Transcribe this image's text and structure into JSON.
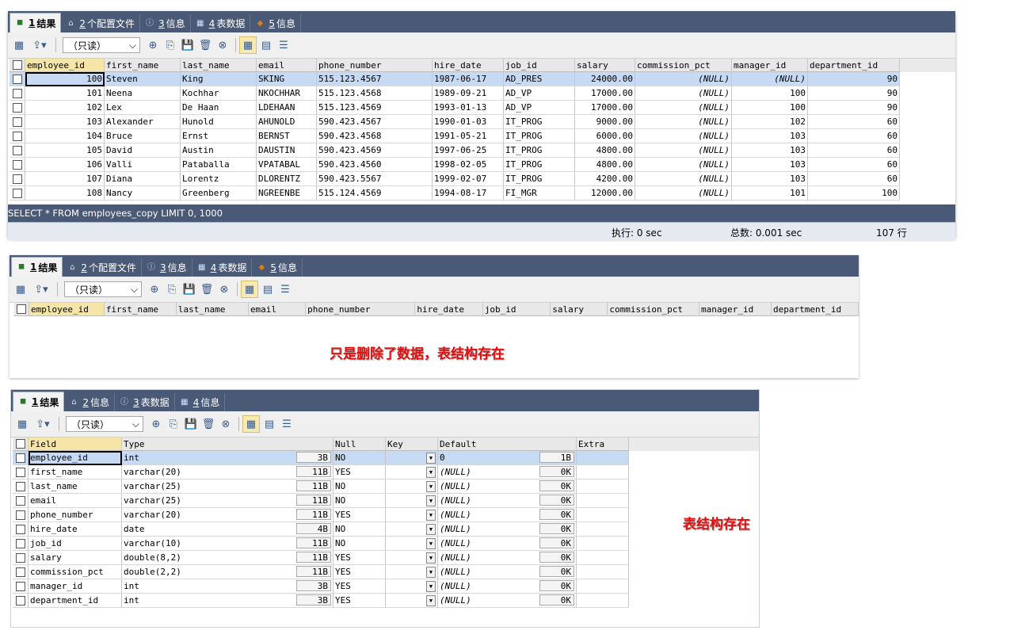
{
  "panel1": {
    "tabs": [
      {
        "num": "1",
        "label": "结果"
      },
      {
        "num": "2",
        "label": "个配置文件"
      },
      {
        "num": "3",
        "label": "信息"
      },
      {
        "num": "4",
        "label": "表数据"
      },
      {
        "num": "5",
        "label": "信息"
      }
    ],
    "readonly": "（只读）",
    "columns": [
      "employee_id",
      "first_name",
      "last_name",
      "email",
      "phone_number",
      "hire_date",
      "job_id",
      "salary",
      "commission_pct",
      "manager_id",
      "department_id"
    ],
    "rows": [
      [
        "100",
        "Steven",
        "King",
        "SKING",
        "515.123.4567",
        "1987-06-17",
        "AD_PRES",
        "24000.00",
        "(NULL)",
        "(NULL)",
        "90"
      ],
      [
        "101",
        "Neena",
        "Kochhar",
        "NKOCHHAR",
        "515.123.4568",
        "1989-09-21",
        "AD_VP",
        "17000.00",
        "(NULL)",
        "100",
        "90"
      ],
      [
        "102",
        "Lex",
        "De Haan",
        "LDEHAAN",
        "515.123.4569",
        "1993-01-13",
        "AD_VP",
        "17000.00",
        "(NULL)",
        "100",
        "90"
      ],
      [
        "103",
        "Alexander",
        "Hunold",
        "AHUNOLD",
        "590.423.4567",
        "1990-01-03",
        "IT_PROG",
        "9000.00",
        "(NULL)",
        "102",
        "60"
      ],
      [
        "104",
        "Bruce",
        "Ernst",
        "BERNST",
        "590.423.4568",
        "1991-05-21",
        "IT_PROG",
        "6000.00",
        "(NULL)",
        "103",
        "60"
      ],
      [
        "105",
        "David",
        "Austin",
        "DAUSTIN",
        "590.423.4569",
        "1997-06-25",
        "IT_PROG",
        "4800.00",
        "(NULL)",
        "103",
        "60"
      ],
      [
        "106",
        "Valli",
        "Pataballa",
        "VPATABAL",
        "590.423.4560",
        "1998-02-05",
        "IT_PROG",
        "4800.00",
        "(NULL)",
        "103",
        "60"
      ],
      [
        "107",
        "Diana",
        "Lorentz",
        "DLORENTZ",
        "590.423.5567",
        "1999-02-07",
        "IT_PROG",
        "4200.00",
        "(NULL)",
        "103",
        "60"
      ],
      [
        "108",
        "Nancy",
        "Greenberg",
        "NGREENBE",
        "515.124.4569",
        "1994-08-17",
        "FI_MGR",
        "12000.00",
        "(NULL)",
        "101",
        "100"
      ]
    ],
    "query": "SELECT * FROM employees_copy LIMIT 0, 1000",
    "exec_time": "执行: 0 sec",
    "total_time": "总数: 0.001 sec",
    "row_count": "107 行"
  },
  "panel2": {
    "tabs": [
      {
        "num": "1",
        "label": "结果"
      },
      {
        "num": "2",
        "label": "个配置文件"
      },
      {
        "num": "3",
        "label": "信息"
      },
      {
        "num": "4",
        "label": "表数据"
      },
      {
        "num": "5",
        "label": "信息"
      }
    ],
    "readonly": "（只读）",
    "columns": [
      "employee_id",
      "first_name",
      "last_name",
      "email",
      "phone_number",
      "hire_date",
      "job_id",
      "salary",
      "commission_pct",
      "manager_id",
      "department_id"
    ],
    "note": "只是删除了数据，表结构存在"
  },
  "panel3": {
    "tabs": [
      {
        "num": "1",
        "label": "结果"
      },
      {
        "num": "2",
        "label": "信息"
      },
      {
        "num": "3",
        "label": "表数据"
      },
      {
        "num": "4",
        "label": "信息"
      }
    ],
    "readonly": "（只读）",
    "columns": [
      "Field",
      "Type",
      "Null",
      "Key",
      "Default",
      "Extra"
    ],
    "rows": [
      {
        "field": "employee_id",
        "type": "int",
        "tsize": "3B",
        "null": "NO",
        "default": "0",
        "dsize": "1B"
      },
      {
        "field": "first_name",
        "type": "varchar(20)",
        "tsize": "11B",
        "null": "YES",
        "default": "(NULL)",
        "dsize": "0K"
      },
      {
        "field": "last_name",
        "type": "varchar(25)",
        "tsize": "11B",
        "null": "NO",
        "default": "(NULL)",
        "dsize": "0K"
      },
      {
        "field": "email",
        "type": "varchar(25)",
        "tsize": "11B",
        "null": "NO",
        "default": "(NULL)",
        "dsize": "0K"
      },
      {
        "field": "phone_number",
        "type": "varchar(20)",
        "tsize": "11B",
        "null": "YES",
        "default": "(NULL)",
        "dsize": "0K"
      },
      {
        "field": "hire_date",
        "type": "date",
        "tsize": "4B",
        "null": "NO",
        "default": "(NULL)",
        "dsize": "0K"
      },
      {
        "field": "job_id",
        "type": "varchar(10)",
        "tsize": "11B",
        "null": "NO",
        "default": "(NULL)",
        "dsize": "0K"
      },
      {
        "field": "salary",
        "type": "double(8,2)",
        "tsize": "11B",
        "null": "YES",
        "default": "(NULL)",
        "dsize": "0K"
      },
      {
        "field": "commission_pct",
        "type": "double(2,2)",
        "tsize": "11B",
        "null": "YES",
        "default": "(NULL)",
        "dsize": "0K"
      },
      {
        "field": "manager_id",
        "type": "int",
        "tsize": "3B",
        "null": "YES",
        "default": "(NULL)",
        "dsize": "0K"
      },
      {
        "field": "department_id",
        "type": "int",
        "tsize": "3B",
        "null": "YES",
        "default": "(NULL)",
        "dsize": "0K"
      }
    ],
    "note": "表结构存在"
  },
  "icons": {
    "toolbar": [
      "grid-add-icon",
      "export-icon",
      "add-row-icon",
      "copy-row-icon",
      "save-icon",
      "delete-icon",
      "cancel-icon",
      "grid-view-icon",
      "form-view-icon",
      "text-view-icon"
    ]
  }
}
